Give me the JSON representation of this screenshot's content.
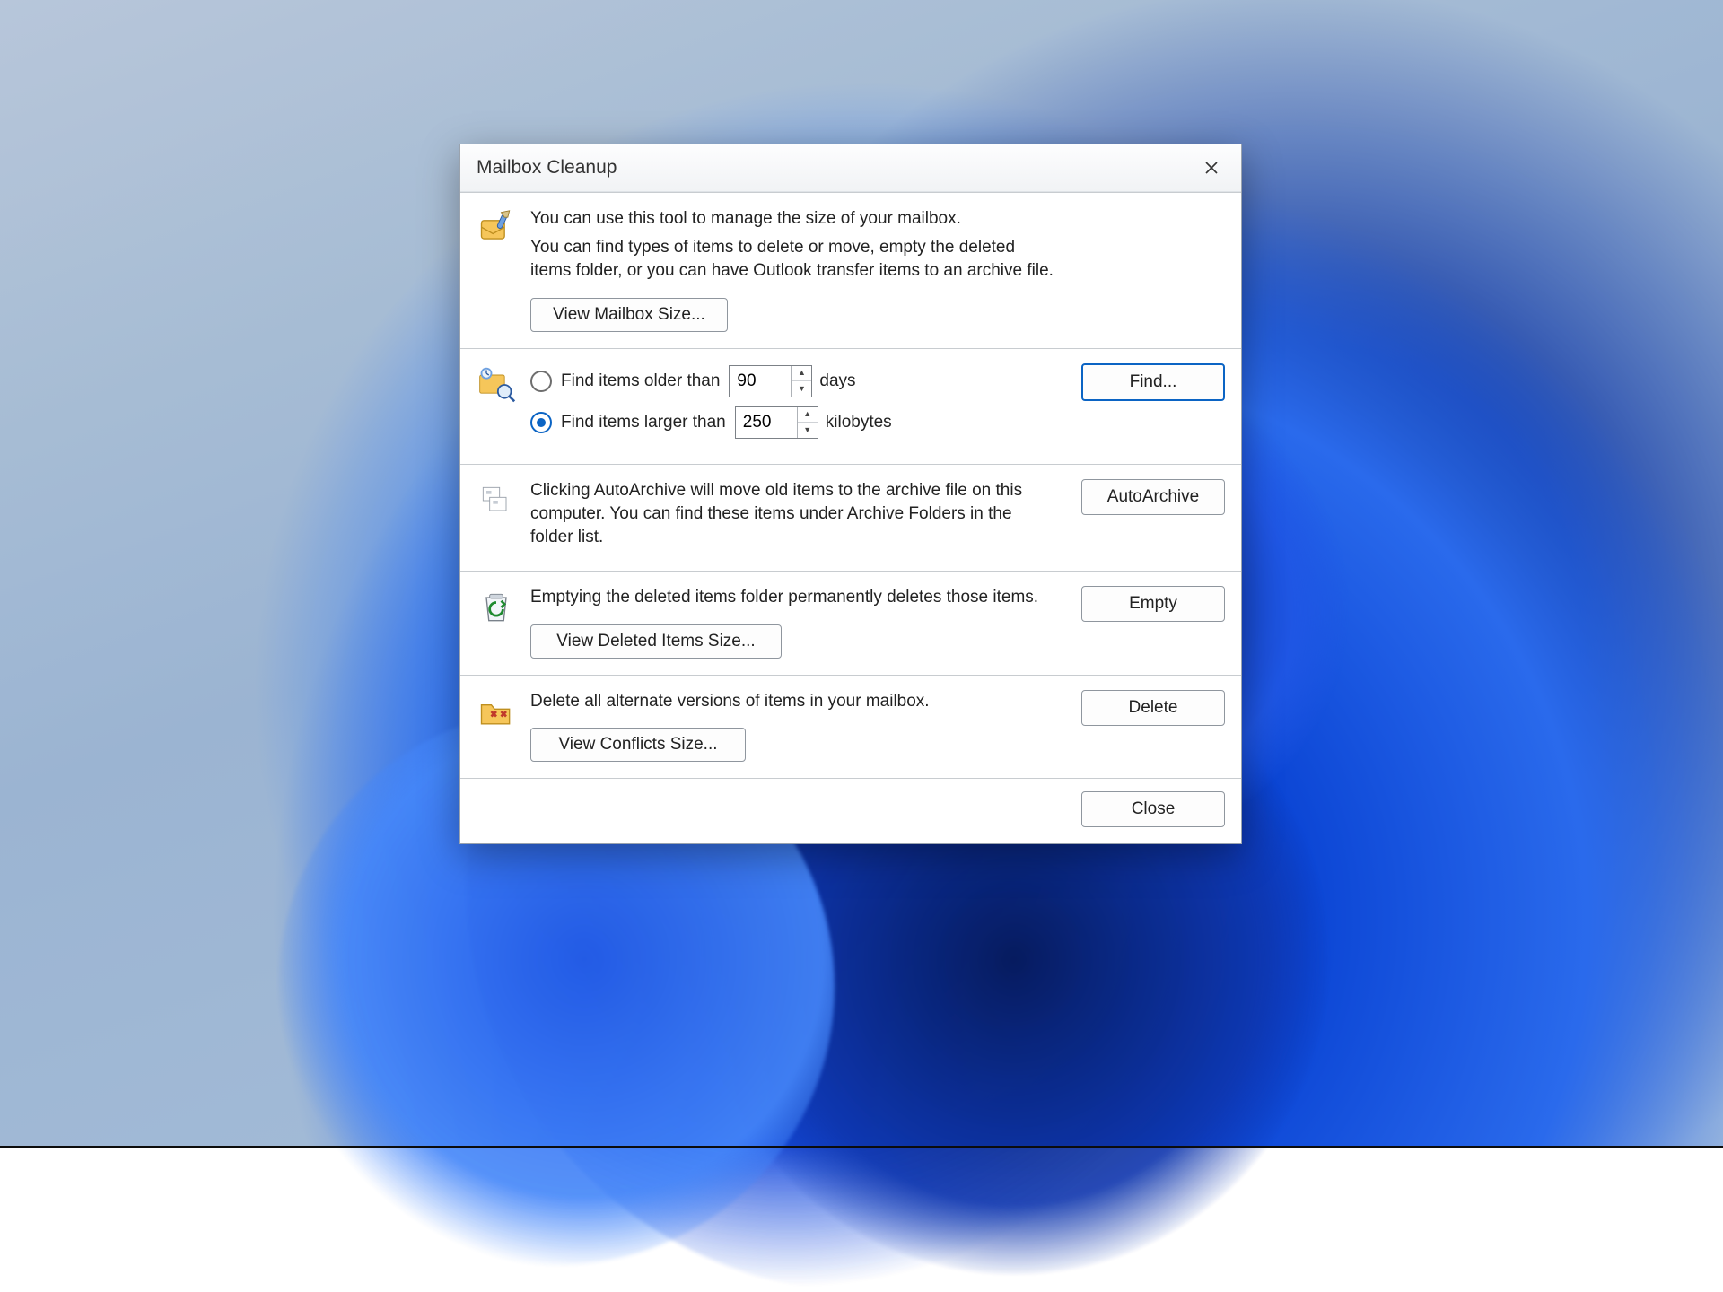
{
  "dialog": {
    "title": "Mailbox Cleanup",
    "intro1": "You can use this tool to manage the size of your mailbox.",
    "intro2": "You can find types of items to delete or move, empty the deleted items folder, or you can have Outlook transfer items to an archive file.",
    "view_mailbox_size": "View Mailbox Size...",
    "find": {
      "older_label": "Find items older than",
      "older_value": "90",
      "older_unit": "days",
      "older_checked": false,
      "larger_label": "Find items larger than",
      "larger_value": "250",
      "larger_unit": "kilobytes",
      "larger_checked": true,
      "find_button": "Find..."
    },
    "autoarchive": {
      "text": "Clicking AutoArchive will move old items to the archive file on this computer. You can find these items under Archive Folders in the folder list.",
      "button": "AutoArchive"
    },
    "empty": {
      "text": "Emptying the deleted items folder permanently deletes those items.",
      "view_button": "View Deleted Items Size...",
      "button": "Empty"
    },
    "conflicts": {
      "text": "Delete all alternate versions of items in your mailbox.",
      "view_button": "View Conflicts Size...",
      "button": "Delete"
    },
    "close": "Close"
  }
}
